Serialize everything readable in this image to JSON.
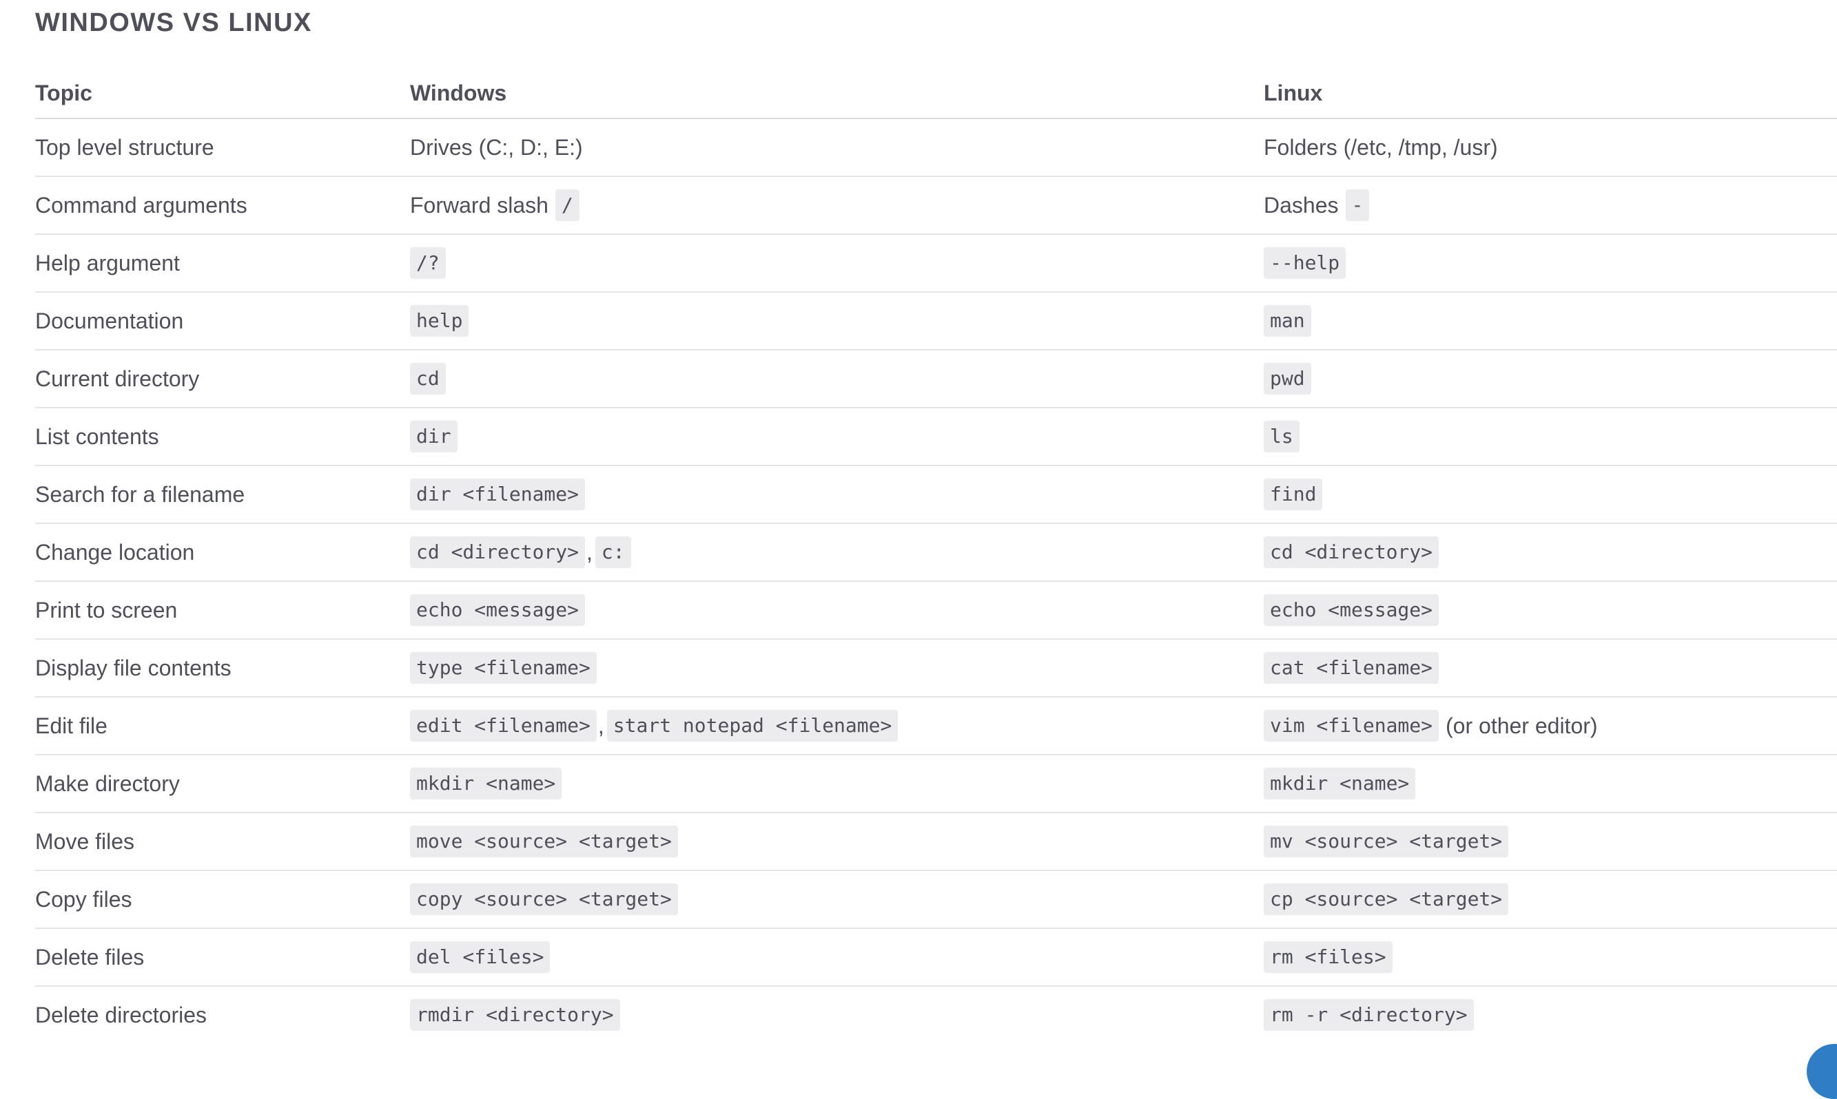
{
  "title": "WINDOWS VS LINUX",
  "table": {
    "headers": [
      "Topic",
      "Windows",
      "Linux"
    ],
    "rows": [
      {
        "topic": "Top level structure",
        "windows": [
          {
            "t": "text",
            "v": "Drives (C:, D:, E:)"
          }
        ],
        "linux": [
          {
            "t": "text",
            "v": "Folders (/etc, /tmp, /usr)"
          }
        ]
      },
      {
        "topic": "Command arguments",
        "windows": [
          {
            "t": "text",
            "v": "Forward slash"
          },
          {
            "t": "code",
            "v": "/"
          }
        ],
        "linux": [
          {
            "t": "text",
            "v": "Dashes"
          },
          {
            "t": "code",
            "v": "-"
          }
        ]
      },
      {
        "topic": "Help argument",
        "windows": [
          {
            "t": "code",
            "v": "/?"
          }
        ],
        "linux": [
          {
            "t": "code",
            "v": "--help"
          }
        ]
      },
      {
        "topic": "Documentation",
        "windows": [
          {
            "t": "code",
            "v": "help"
          }
        ],
        "linux": [
          {
            "t": "code",
            "v": "man"
          }
        ]
      },
      {
        "topic": "Current directory",
        "windows": [
          {
            "t": "code",
            "v": "cd"
          }
        ],
        "linux": [
          {
            "t": "code",
            "v": "pwd"
          }
        ]
      },
      {
        "topic": "List contents",
        "windows": [
          {
            "t": "code",
            "v": "dir"
          }
        ],
        "linux": [
          {
            "t": "code",
            "v": "ls"
          }
        ]
      },
      {
        "topic": "Search for a filename",
        "windows": [
          {
            "t": "code",
            "v": "dir <filename>"
          }
        ],
        "linux": [
          {
            "t": "code",
            "v": "find"
          }
        ]
      },
      {
        "topic": "Change location",
        "windows": [
          {
            "t": "code",
            "v": "cd <directory>"
          },
          {
            "t": "sep",
            "v": ","
          },
          {
            "t": "code",
            "v": "c:"
          }
        ],
        "linux": [
          {
            "t": "code",
            "v": "cd <directory>"
          }
        ]
      },
      {
        "topic": "Print to screen",
        "windows": [
          {
            "t": "code",
            "v": "echo <message>"
          }
        ],
        "linux": [
          {
            "t": "code",
            "v": "echo <message>"
          }
        ]
      },
      {
        "topic": "Display file contents",
        "windows": [
          {
            "t": "code",
            "v": "type <filename>"
          }
        ],
        "linux": [
          {
            "t": "code",
            "v": "cat <filename>"
          }
        ]
      },
      {
        "topic": "Edit file",
        "windows": [
          {
            "t": "code",
            "v": "edit <filename>"
          },
          {
            "t": "sep",
            "v": ","
          },
          {
            "t": "code",
            "v": "start notepad <filename>"
          }
        ],
        "linux": [
          {
            "t": "code",
            "v": "vim <filename>"
          },
          {
            "t": "text_after",
            "v": "(or other editor)"
          }
        ]
      },
      {
        "topic": "Make directory",
        "windows": [
          {
            "t": "code",
            "v": "mkdir <name>"
          }
        ],
        "linux": [
          {
            "t": "code",
            "v": "mkdir <name>"
          }
        ]
      },
      {
        "topic": "Move files",
        "windows": [
          {
            "t": "code",
            "v": "move <source> <target>"
          }
        ],
        "linux": [
          {
            "t": "code",
            "v": "mv <source> <target>"
          }
        ]
      },
      {
        "topic": "Copy files",
        "windows": [
          {
            "t": "code",
            "v": "copy <source> <target>"
          }
        ],
        "linux": [
          {
            "t": "code",
            "v": "cp <source> <target>"
          }
        ]
      },
      {
        "topic": "Delete files",
        "windows": [
          {
            "t": "code",
            "v": "del <files>"
          }
        ],
        "linux": [
          {
            "t": "code",
            "v": "rm <files>"
          }
        ]
      },
      {
        "topic": "Delete directories",
        "windows": [
          {
            "t": "code",
            "v": "rmdir <directory>"
          }
        ],
        "linux": [
          {
            "t": "code",
            "v": "rm -r <directory>"
          }
        ]
      }
    ]
  },
  "colors": {
    "text": "#4f4f5a",
    "code_background": "#ececee",
    "row_divider": "#e3e3e6",
    "corner_badge": "#2f7dc4"
  }
}
